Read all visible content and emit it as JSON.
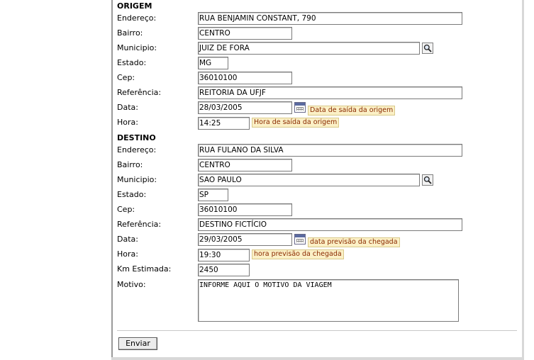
{
  "origem": {
    "title": "ORIGEM",
    "endereco_label": "Endereço:",
    "endereco_value": "RUA BENJAMIN CONSTANT, 790",
    "bairro_label": "Bairro:",
    "bairro_value": "CENTRO",
    "municipio_label": "Municipio:",
    "municipio_value": "JUIZ DE FORA",
    "estado_label": "Estado:",
    "estado_value": "MG",
    "cep_label": "Cep:",
    "cep_value": "36010100",
    "referencia_label": "Referência:",
    "referencia_value": "REITORIA DA UFJF",
    "data_label": "Data:",
    "data_value": "28/03/2005",
    "data_hint": "Data de saída da origem",
    "hora_label": "Hora:",
    "hora_value": "14:25",
    "hora_hint": "Hora de saída da origem"
  },
  "destino": {
    "title": "DESTINO",
    "endereco_label": "Endereço:",
    "endereco_value": "RUA FULANO DA SILVA",
    "bairro_label": "Bairro:",
    "bairro_value": "CENTRO",
    "municipio_label": "Municipio:",
    "municipio_value": "SAO PAULO",
    "estado_label": "Estado:",
    "estado_value": "SP",
    "cep_label": "Cep:",
    "cep_value": "36010100",
    "referencia_label": "Referência:",
    "referencia_value": "DESTINO FICTÍCIO",
    "data_label": "Data:",
    "data_value": "29/03/2005",
    "data_hint": "data previsão da chegada",
    "hora_label": "Hora:",
    "hora_value": "19:30",
    "hora_hint": "hora previsão da chegada"
  },
  "extra": {
    "km_label": "Km Estimada:",
    "km_value": "2450",
    "motivo_label": "Motivo:",
    "motivo_value": "INFORME AQUI O MOTIVO DA VIAGEM"
  },
  "actions": {
    "send_label": "Enviar"
  },
  "icons": {
    "search": "magnifier-icon",
    "calendar": "calendar-icon"
  }
}
